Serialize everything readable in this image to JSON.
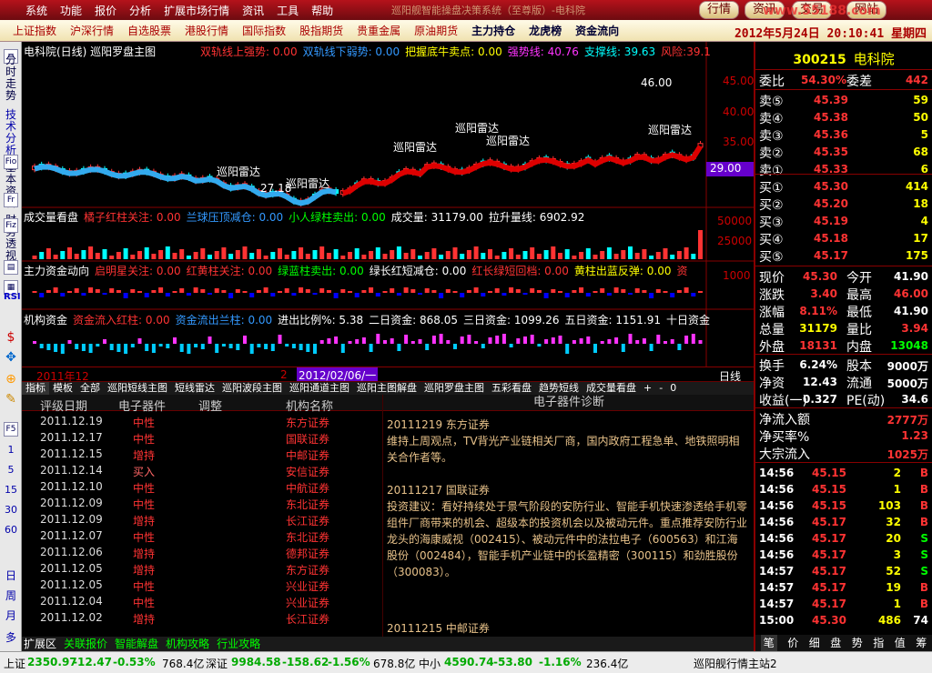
{
  "menu": [
    "系统",
    "功能",
    "报价",
    "分析",
    "扩展市场行情",
    "资讯",
    "工具",
    "帮助"
  ],
  "window_title": "巡阳舰智能操盘决策系统（至尊版）-电科院",
  "top_buttons": [
    "行情",
    "资讯",
    "交易",
    "网站"
  ],
  "brand": "www.55188.com",
  "nav": [
    "上证指数",
    "沪深行情",
    "自选股票",
    "港股行情",
    "国际指数",
    "股指期货",
    "贵重金属",
    "原油期货",
    "主力持仓",
    "龙虎榜",
    "资金流向"
  ],
  "datetime": "2012年5月24日  20:10:41  星期四",
  "leftbar": {
    "vtext1": "分时走势",
    "vtext2": "技术分析",
    "vtext3": "基本资料",
    "vtext4": "财务透视",
    "icons": [
      "Fio",
      "Fr",
      "Fiz",
      "RSI"
    ],
    "periods": [
      "1",
      "5",
      "15",
      "30",
      "60",
      "日",
      "周",
      "月",
      "多"
    ]
  },
  "main_panel": {
    "title": "电科院(日线) 巡阳罗盘主图",
    "ind": [
      {
        "t": "双轨线上强势: 0.00",
        "c": "#f33"
      },
      {
        "t": "双轨线下弱势: 0.00",
        "c": "#39f"
      },
      {
        "t": "把握底牛卖点: 0.00",
        "c": "#ff0"
      },
      {
        "t": "强势线: 40.76",
        "c": "#f3f"
      },
      {
        "t": "支撑线: 39.63",
        "c": "#0ff"
      },
      {
        "t": "风险:39.1",
        "c": "#f33"
      }
    ],
    "price_labels": [
      "45.00",
      "40.00",
      "35.00"
    ],
    "current_price": "29.00",
    "annot": [
      {
        "t": "巡阳雷达"
      },
      {
        "t": "巡阳雷达"
      },
      {
        "t": "巡阳雷达"
      },
      {
        "t": "巡阳雷达"
      },
      {
        "t": "巡阳雷达"
      },
      {
        "t": "巡阳雷达"
      }
    ],
    "high": "46.00",
    "low": "27.18"
  },
  "vol_panel": {
    "title": "成交量看盘",
    "ind": [
      {
        "t": "橘子红柱关注: 0.00",
        "c": "#f33"
      },
      {
        "t": "兰球压顶减仓: 0.00",
        "c": "#39f"
      },
      {
        "t": "小人绿柱卖出: 0.00",
        "c": "#0f0"
      },
      {
        "t": "成交量: 31179.00",
        "c": "#fff"
      },
      {
        "t": "拉升量线: 6902.92",
        "c": "#fff"
      }
    ],
    "labels": [
      "50000",
      "25000"
    ]
  },
  "fund_panel": {
    "title": "主力资金动向",
    "ind": [
      {
        "t": "启明星关注: 0.00",
        "c": "#f33"
      },
      {
        "t": "红黄柱关注: 0.00",
        "c": "#f33"
      },
      {
        "t": "绿蓝柱卖出: 0.00",
        "c": "#0f0"
      },
      {
        "t": "绿长红短减仓: 0.00",
        "c": "#fff"
      },
      {
        "t": "红长绿短回档: 0.00",
        "c": "#f33"
      },
      {
        "t": "黄柱出蓝反弹: 0.00",
        "c": "#ff0"
      },
      {
        "t": "资",
        "c": "#f33"
      }
    ],
    "label": "1000"
  },
  "inst_panel": {
    "title": "机构资金",
    "ind": [
      {
        "t": "资金流入红柱: 0.00",
        "c": "#f33"
      },
      {
        "t": "资金流出兰柱: 0.00",
        "c": "#39f"
      },
      {
        "t": "进出比例%: 5.38",
        "c": "#fff"
      },
      {
        "t": "二日资金: 868.05",
        "c": "#fff"
      },
      {
        "t": "三日资金: 1099.26",
        "c": "#fff"
      },
      {
        "t": "五日资金: 1151.91",
        "c": "#fff"
      },
      {
        "t": "十日资金",
        "c": "#fff"
      }
    ]
  },
  "timeaxis": {
    "start": "2011年12",
    "mid": "2",
    "cursor": "2012/02/06/一",
    "period": "日线"
  },
  "tabs": [
    "指标",
    "模板",
    "全部",
    "巡阳短线主图",
    "短线雷达",
    "巡阳波段主图",
    "巡阳通道主图",
    "巡阳主图解盘",
    "巡阳罗盘主图",
    "五彩看盘",
    "趋势短线",
    "成交量看盘",
    "+",
    "-",
    "0"
  ],
  "table": {
    "headers": [
      "评级日期",
      "电子器件",
      "调整",
      "机构名称"
    ],
    "rows": [
      [
        "2011.12.19",
        "中性",
        "",
        "东方证券"
      ],
      [
        "2011.12.17",
        "中性",
        "",
        "国联证券"
      ],
      [
        "2011.12.15",
        "增持",
        "",
        "中邮证券"
      ],
      [
        "2011.12.14",
        "买入",
        "",
        "安信证券"
      ],
      [
        "2011.12.10",
        "中性",
        "",
        "中航证券"
      ],
      [
        "2011.12.09",
        "中性",
        "",
        "东北证券"
      ],
      [
        "2011.12.09",
        "增持",
        "",
        "长江证券"
      ],
      [
        "2011.12.07",
        "中性",
        "",
        "东北证券"
      ],
      [
        "2011.12.06",
        "增持",
        "",
        "德邦证券"
      ],
      [
        "2011.12.05",
        "增持",
        "",
        "东方证券"
      ],
      [
        "2011.12.05",
        "中性",
        "",
        "兴业证券"
      ],
      [
        "2011.12.04",
        "中性",
        "",
        "兴业证券"
      ],
      [
        "2011.12.02",
        "增持",
        "",
        "长江证券"
      ]
    ]
  },
  "diagnosis": {
    "title": "电子器件诊断",
    "paras": [
      "20111219 东方证券",
      "    维持上周观点，TV背光产业链相关厂商，国内政府工程急单、地铁照明相关合作者等。",
      "20111217 国联证券",
      "    投资建议：看好持续处于景气阶段的安防行业、智能手机快速渗透给手机零组件厂商带来的机会、超级本的投资机会以及被动元件。重点推荐安防行业龙头的海康威视（002415）、被动元件中的法拉电子（600563）和江海股份（002484），智能手机产业链中的长盈精密（300115）和劲胜股份（300083）。",
      "20111215 中邮证券"
    ]
  },
  "bottom_tabs": [
    "扩展区",
    "关联报价",
    "智能解盘",
    "机构攻略",
    "行业攻略"
  ],
  "status": {
    "sh_name": "上证",
    "sh_val": "2350.97",
    "sh_chg": "-12.47",
    "sh_pct": "-0.53%",
    "sh_amt": "768.4亿",
    "sz_name": "深证",
    "sz_val": "9984.58",
    "sz_chg": "-158.62",
    "sz_pct": "-1.56%",
    "sz_amt": "678.8亿",
    "zx_name": "中小",
    "zx_val": "4590.74",
    "zx_chg": "-53.80",
    "zx_pct": "-1.16%",
    "zx_amt": "236.4亿",
    "station": "巡阳舰行情主站2"
  },
  "right": {
    "code": "300215",
    "name": "电科院",
    "weibi_lbl": "委比",
    "weibi": "54.30%",
    "weicha_lbl": "委差",
    "weicha": "442",
    "sells": [
      [
        "卖⑤",
        "45.39",
        "59"
      ],
      [
        "卖④",
        "45.38",
        "50"
      ],
      [
        "卖③",
        "45.36",
        "5"
      ],
      [
        "卖②",
        "45.35",
        "68"
      ],
      [
        "卖①",
        "45.33",
        "6"
      ]
    ],
    "buys": [
      [
        "买①",
        "45.30",
        "414"
      ],
      [
        "买②",
        "45.20",
        "18"
      ],
      [
        "买③",
        "45.19",
        "4"
      ],
      [
        "买④",
        "45.18",
        "17"
      ],
      [
        "买⑤",
        "45.17",
        "175"
      ]
    ],
    "stats": [
      [
        "现价",
        "45.30",
        "今开",
        "41.90"
      ],
      [
        "涨跌",
        "3.40",
        "最高",
        "46.00"
      ],
      [
        "涨幅",
        "8.11%",
        "最低",
        "41.90"
      ],
      [
        "总量",
        "31179",
        "量比",
        "3.94"
      ],
      [
        "外盘",
        "18131",
        "内盘",
        "13048"
      ]
    ],
    "stats2": [
      [
        "换手",
        "6.24%",
        "股本",
        "9000万"
      ],
      [
        "净资",
        "12.43",
        "流通",
        "5000万"
      ],
      [
        "收益(一)",
        "0.327",
        "PE(动)",
        "34.6"
      ]
    ],
    "flow": [
      [
        "净流入额",
        "2777万"
      ],
      [
        "净买率%",
        "1.23"
      ],
      [
        "大宗流入",
        "1025万"
      ]
    ],
    "ticks": [
      [
        "14:56",
        "45.15",
        "2",
        "B"
      ],
      [
        "14:56",
        "45.15",
        "1",
        "B"
      ],
      [
        "14:56",
        "45.15",
        "103",
        "B"
      ],
      [
        "14:56",
        "45.17",
        "32",
        "B"
      ],
      [
        "14:56",
        "45.17",
        "20",
        "S"
      ],
      [
        "14:56",
        "45.17",
        "3",
        "S"
      ],
      [
        "14:57",
        "45.17",
        "52",
        "S"
      ],
      [
        "14:57",
        "45.17",
        "19",
        "B"
      ],
      [
        "14:57",
        "45.17",
        "1",
        "B"
      ],
      [
        "15:00",
        "45.30",
        "486",
        "74"
      ]
    ],
    "tabs": [
      "笔",
      "价",
      "细",
      "盘",
      "势",
      "指",
      "值",
      "筹"
    ]
  }
}
